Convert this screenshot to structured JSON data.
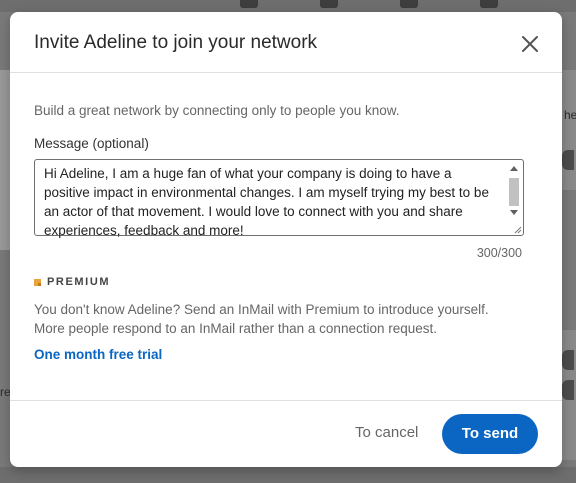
{
  "dialog": {
    "title": "Invite Adeline to join your network",
    "intro": "Build a great network by connecting only to people you know.",
    "message_label": "Message (optional)",
    "message_lines": [
      "Hi Adeline, I am a huge fan of what your company is doing to have a",
      "positive impact in environmental changes. I am myself trying my best to be",
      "an actor of that movement. I would love to connect with you and share",
      "experiences, feedback and more!"
    ],
    "char_count": "300/300",
    "premium_label": "PREMIUM",
    "premium_text_lines": [
      "You don't know Adeline? Send an InMail with Premium to introduce yourself.",
      "More people respond to an InMail rather than a connection request."
    ],
    "trial_link": "One month free trial",
    "cancel_label": "To cancel",
    "send_label": "To send"
  },
  "background": {
    "right_edge_char": "he",
    "left_edge_char": "re"
  },
  "colors": {
    "accent": "#0a66c2",
    "premium_gold": "#e7a33e"
  },
  "icons": [
    "close-icon",
    "premium-icon",
    "scroll-up-icon",
    "scroll-down-icon",
    "resize-grip-icon"
  ]
}
